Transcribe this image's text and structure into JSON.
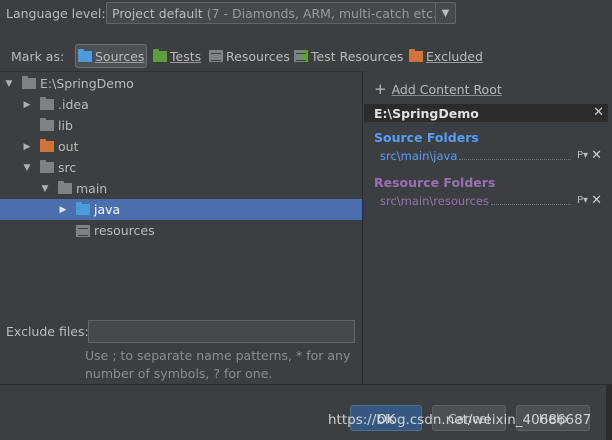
{
  "language_level": {
    "label": "Language level:",
    "selected_main": "Project default",
    "selected_hint": " (7 - Diamonds, ARM, multi-catch etc.)"
  },
  "mark_as": {
    "label": "Mark as:",
    "buttons": [
      {
        "label": "Sources",
        "icon": "sources-folder-icon",
        "color": "#4a9cdb"
      },
      {
        "label": "Tests",
        "icon": "tests-folder-icon",
        "color": "#5f9e3e"
      },
      {
        "label": "Resources",
        "icon": "resources-folder-icon",
        "color": "#7c8285"
      },
      {
        "label": "Test Resources",
        "icon": "test-resources-folder-icon",
        "color": "#5f9e3e"
      },
      {
        "label": "Excluded",
        "icon": "excluded-folder-icon",
        "color": "#d0743c"
      }
    ]
  },
  "tree": [
    {
      "label": "E:\\SpringDemo",
      "expanded": true
    },
    {
      "label": ".idea",
      "expanded": false
    },
    {
      "label": "lib"
    },
    {
      "label": "out",
      "expanded": false
    },
    {
      "label": "src",
      "expanded": true
    },
    {
      "label": "main",
      "expanded": true
    },
    {
      "label": "java",
      "expanded": false,
      "selected": true
    },
    {
      "label": "resources"
    }
  ],
  "exclude": {
    "label": "Exclude files:",
    "value": "",
    "hint": "Use ; to separate name patterns, * for any number of symbols, ? for one."
  },
  "content_root": {
    "add_label": "Add Content Root",
    "root_path": "E:\\SpringDemo",
    "source_folders_title": "Source Folders",
    "source_path": "src\\main\\java",
    "resource_folders_title": "Resource Folders",
    "resource_path": "src\\main\\resources"
  },
  "buttons": {
    "ok": "OK",
    "cancel": "Cancel",
    "help": "Help"
  },
  "watermark": "https://blog.csdn.net/weixin_40686687",
  "colors": {
    "background": "#3c3f41",
    "selection": "#4b6eaf",
    "source": "#589df6",
    "resource": "#9b6fb3"
  }
}
